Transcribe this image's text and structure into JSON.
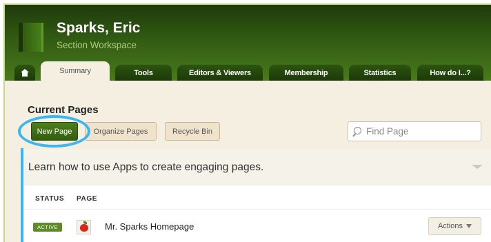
{
  "header": {
    "title": "Sparks, Eric",
    "subtitle": "Section Workspace"
  },
  "tabs": [
    {
      "label": "Summary",
      "active": true
    },
    {
      "label": "Tools"
    },
    {
      "label": "Editors & Viewers"
    },
    {
      "label": "Membership"
    },
    {
      "label": "Statistics"
    },
    {
      "label": "How do I...?"
    }
  ],
  "content": {
    "section_title": "Current Pages",
    "buttons": {
      "new_page": "New Page",
      "organize_pages": "Organize Pages",
      "recycle_bin": "Recycle Bin"
    },
    "find": {
      "placeholder": "Find Page"
    }
  },
  "panel": {
    "learn_text": "Learn how to use Apps to create engaging pages.",
    "columns": {
      "status": "STATUS",
      "page": "PAGE"
    },
    "rows": [
      {
        "status": "ACTIVE",
        "title": "Mr. Sparks Homepage",
        "actions": "Actions",
        "icon": "apple-icon"
      }
    ]
  },
  "colors": {
    "header_green": "#2f5812",
    "highlight_blue": "#3cb6f2",
    "status_active": "#5f8a2a"
  }
}
